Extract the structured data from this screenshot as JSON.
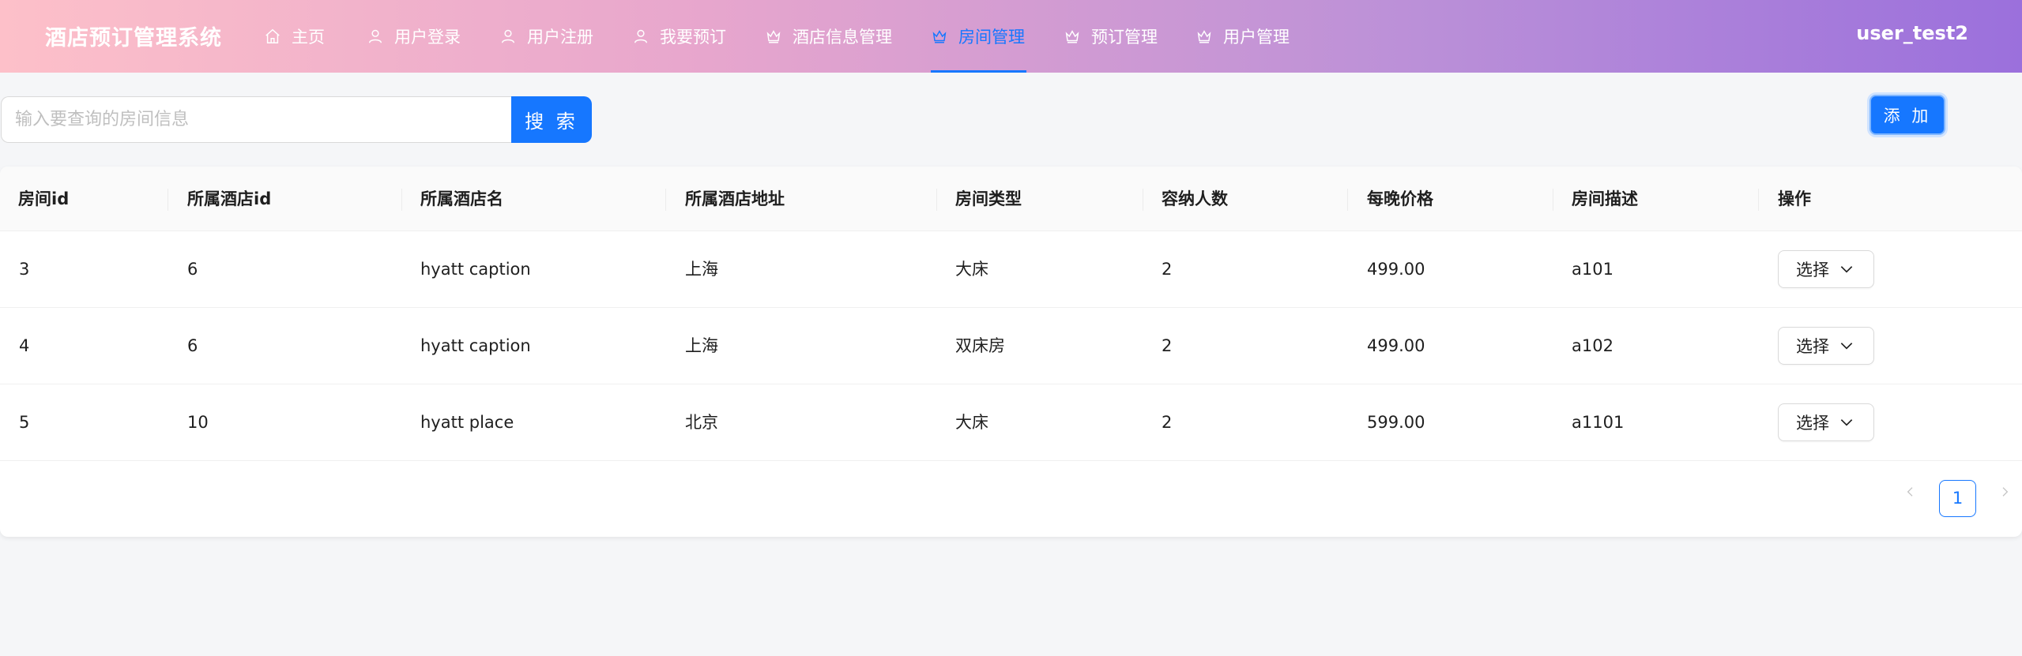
{
  "header": {
    "app_title": "酒店预订管理系统",
    "user_name": "user_test2",
    "nav": [
      {
        "label": "主页",
        "icon": "home-icon"
      },
      {
        "label": "用户登录",
        "icon": "user-icon"
      },
      {
        "label": "用户注册",
        "icon": "user-icon"
      },
      {
        "label": "我要预订",
        "icon": "user-icon"
      },
      {
        "label": "酒店信息管理",
        "icon": "crown-icon"
      },
      {
        "label": "房间管理",
        "icon": "crown-icon",
        "active": true
      },
      {
        "label": "预订管理",
        "icon": "crown-icon"
      },
      {
        "label": "用户管理",
        "icon": "crown-icon"
      }
    ]
  },
  "search": {
    "placeholder": "输入要查询的房间信息",
    "value": "",
    "button_label": "搜 索"
  },
  "toolbar": {
    "add_label": "添 加"
  },
  "table": {
    "columns": [
      "房间id",
      "所属酒店id",
      "所属酒店名",
      "所属酒店地址",
      "房间类型",
      "容纳人数",
      "每晚价格",
      "房间描述",
      "操作"
    ],
    "rows": [
      {
        "room_id": "3",
        "hotel_id": "6",
        "hotel_name": "hyatt caption",
        "hotel_address": "上海",
        "room_type": "大床",
        "capacity": "2",
        "price": "499.00",
        "description": "a101",
        "action": "选择"
      },
      {
        "room_id": "4",
        "hotel_id": "6",
        "hotel_name": "hyatt caption",
        "hotel_address": "上海",
        "room_type": "双床房",
        "capacity": "2",
        "price": "499.00",
        "description": "a102",
        "action": "选择"
      },
      {
        "room_id": "5",
        "hotel_id": "10",
        "hotel_name": "hyatt place",
        "hotel_address": "北京",
        "room_type": "大床",
        "capacity": "2",
        "price": "599.00",
        "description": "a1101",
        "action": "选择"
      }
    ]
  },
  "pagination": {
    "current_page": "1"
  },
  "colors": {
    "accent": "#1677ff",
    "header_gradient_start": "#fdc0c9",
    "header_gradient_end": "#9b70dc"
  }
}
